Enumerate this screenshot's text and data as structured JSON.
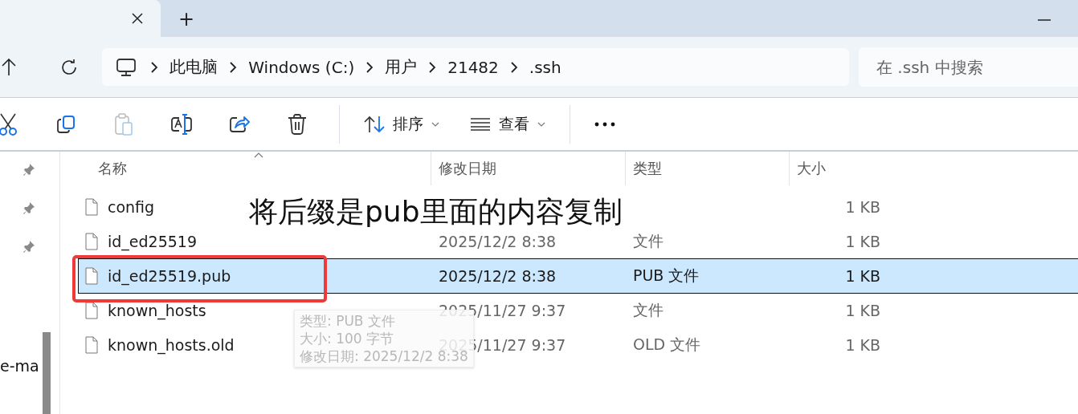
{
  "tab_bar": {
    "add_tab": "+"
  },
  "address_bar": {
    "breadcrumbs": [
      "此电脑",
      "Windows (C:)",
      "用户",
      "21482",
      ".ssh"
    ]
  },
  "search": {
    "placeholder": "在 .ssh 中搜索"
  },
  "toolbar": {
    "actions": [
      {
        "kind": "cut",
        "disabled": false
      },
      {
        "kind": "copy",
        "disabled": false
      },
      {
        "kind": "paste",
        "disabled": true
      },
      {
        "kind": "rename",
        "disabled": false
      },
      {
        "kind": "share",
        "disabled": false
      },
      {
        "kind": "delete",
        "disabled": false
      }
    ],
    "sort": "排序",
    "view": "查看"
  },
  "nav_pane": {
    "items": [
      {
        "kind": "pin"
      },
      {
        "kind": "pin"
      },
      {
        "kind": "pin"
      },
      {
        "kind": "text",
        "label": "e-ma"
      }
    ]
  },
  "table": {
    "columns": [
      "名称",
      "修改日期",
      "类型",
      "大小"
    ],
    "rows": [
      {
        "name": "config",
        "size": "1 KB",
        "selected": false
      },
      {
        "name": "id_ed25519",
        "modified": "2025/12/2 8:38",
        "type": "文件",
        "size": "1 KB",
        "selected": false
      },
      {
        "name": "id_ed25519.pub",
        "modified": "2025/12/2 8:38",
        "type": "PUB 文件",
        "size": "1 KB",
        "selected": true
      },
      {
        "name": "known_hosts",
        "modified": "2025/11/27 9:37",
        "type": "文件",
        "size": "1 KB",
        "selected": false
      },
      {
        "name": "known_hosts.old",
        "modified": "2025/11/27 9:37",
        "type": "OLD 文件",
        "size": "1 KB",
        "selected": false
      }
    ]
  },
  "annotation": {
    "text": "将后缀是pub里面的内容复制"
  },
  "tooltip": {
    "lines": [
      "类型: PUB 文件",
      "大小: 100 字节",
      "修改日期: 2025/12/2 8:38"
    ]
  }
}
